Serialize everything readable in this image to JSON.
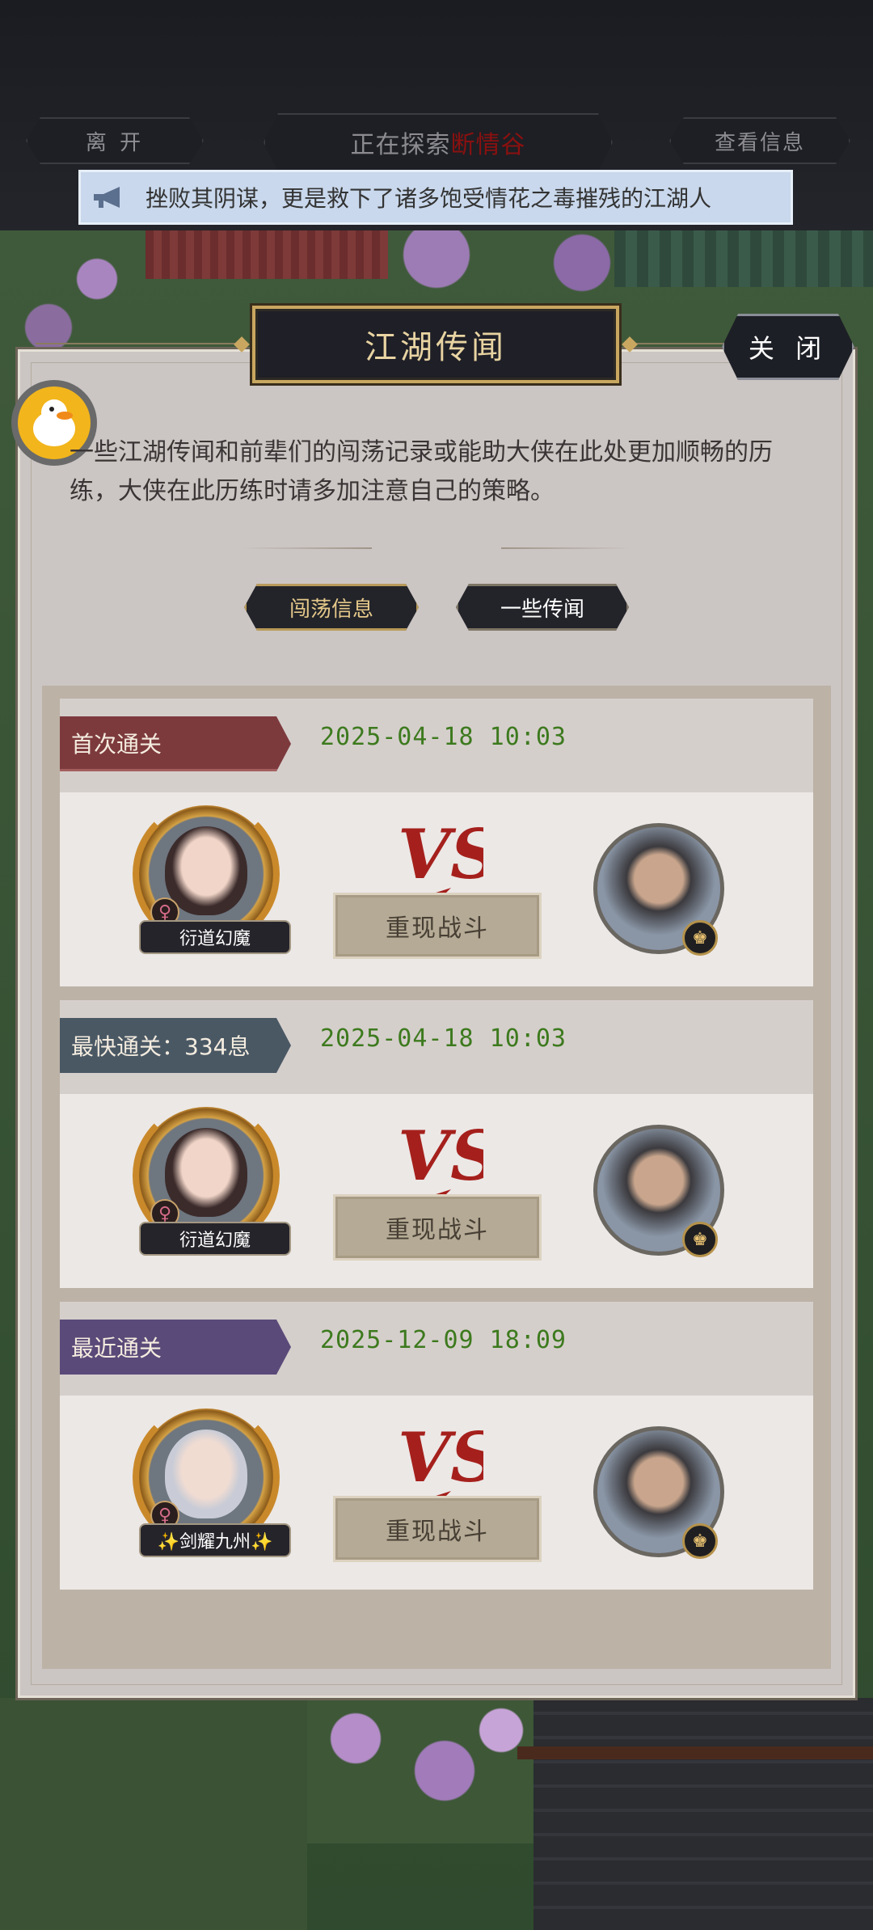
{
  "top_bar": {
    "leave_label": "离 开",
    "explore_prefix": "正在探索",
    "explore_location": "断情谷",
    "view_info_label": "查看信息"
  },
  "notice": {
    "text": "挫败其阴谋，更是救下了诸多饱受情花之毒摧残的江湖人",
    "icon": "megaphone-icon"
  },
  "panel": {
    "title": "江湖传闻",
    "close_label": "关 闭",
    "intro": "一些江湖传闻和前辈们的闯荡记录或能助大侠在此处更加顺畅的历练，大侠在此历练时请多加注意自己的策略。",
    "tabs": [
      {
        "label": "闯荡信息",
        "active": true
      },
      {
        "label": "一些传闻",
        "active": false
      }
    ]
  },
  "records": [
    {
      "badge": "首次通关",
      "timestamp": "2025-04-18 10:03",
      "hero_name": "衍道幻魔",
      "gender_symbol": "♀",
      "vs_label": "VS",
      "replay_label": "重现战斗",
      "boss_badge_symbol": "♚"
    },
    {
      "badge": "最快通关：334息",
      "timestamp": "2025-04-18 10:03",
      "hero_name": "衍道幻魔",
      "gender_symbol": "♀",
      "vs_label": "VS",
      "replay_label": "重现战斗",
      "boss_badge_symbol": "♚"
    },
    {
      "badge": "最近通关",
      "timestamp": "2025-12-09 18:09",
      "hero_name": "✨剑耀九州✨",
      "gender_symbol": "♀",
      "vs_label": "VS",
      "replay_label": "重现战斗",
      "boss_badge_symbol": "♚"
    }
  ],
  "colors": {
    "timestamp_green": "#3d7a1e",
    "location_red": "#8a1010",
    "vs_red": "#a5201c",
    "title_gold": "#e8d4a2"
  }
}
